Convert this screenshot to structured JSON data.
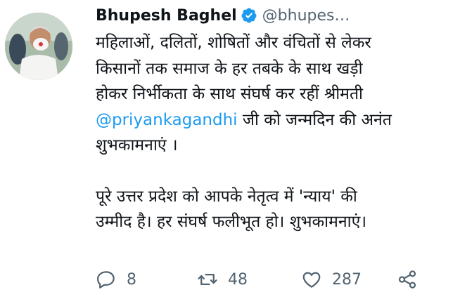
{
  "author": {
    "name": "Bhupesh Baghel",
    "handle": "@bhupes…"
  },
  "tweet": {
    "line1": "महिलाओं, दलितों, शोषितों और वंचितों से लेकर",
    "line2": "किसानों तक समाज के हर तबके के साथ खड़ी",
    "line3": "होकर निर्भीकता के साथ संघर्ष कर रहीं श्रीमती",
    "mention": "@priyankagandhi",
    "line4_rest": " जी को जन्मदिन की अनंत",
    "line5": "शुभकामनाएं ।",
    "para2_line1": "पूरे उत्तर प्रदेश को आपके नेतृत्व में 'न्याय' की",
    "para2_line2": "उम्मीद है। हर संघर्ष फलीभूत हो। शुभकामनाएं।"
  },
  "actions": {
    "reply_count": "8",
    "retweet_count": "48",
    "like_count": "287"
  },
  "colors": {
    "text": "#0f1419",
    "secondary": "#536471",
    "link": "#1d9bf0",
    "verified": "#1d9bf0"
  },
  "icons": [
    "verified-badge-icon",
    "reply-icon",
    "retweet-icon",
    "like-icon",
    "share-icon"
  ]
}
